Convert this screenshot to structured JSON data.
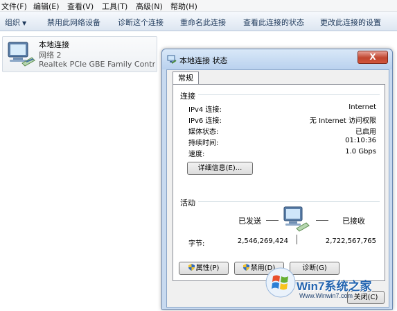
{
  "menu": [
    "文件(F)",
    "编辑(E)",
    "查看(V)",
    "工具(T)",
    "高级(N)",
    "帮助(H)"
  ],
  "toolbar": {
    "organize": "组织",
    "disable": "禁用此网络设备",
    "diagnose": "诊断这个连接",
    "rename": "重命名此连接",
    "view_status": "查看此连接的状态",
    "change_settings": "更改此连接的设置"
  },
  "connection": {
    "name": "本地连接",
    "network": "网络  2",
    "adapter": "Realtek PCIe GBE Family Contr..."
  },
  "dialog": {
    "title": "本地连接 状态",
    "close": "X",
    "tab": "常规",
    "connection_group": "连接",
    "rows": [
      {
        "label": "IPv4 连接:",
        "value": "Internet"
      },
      {
        "label": "IPv6 连接:",
        "value": "无 Internet 访问权限"
      },
      {
        "label": "媒体状态:",
        "value": "已启用"
      },
      {
        "label": "持续时间:",
        "value": "01:10:36"
      },
      {
        "label": "速度:",
        "value": "1.0 Gbps"
      }
    ],
    "details_button": "详细信息(E)...",
    "activity_group": "活动",
    "sent_label": "已发送",
    "received_label": "已接收",
    "bytes_label": "字节:",
    "bytes_sent": "2,546,269,424",
    "bytes_received": "2,722,567,765",
    "properties_button": "属性(P)",
    "disable_button": "禁用(D)",
    "diagnose_button": "诊断(G)",
    "close_button": "关闭(C)"
  },
  "watermark": {
    "brand": "Win7系统之家",
    "url": "Www.Winwin7.com"
  }
}
